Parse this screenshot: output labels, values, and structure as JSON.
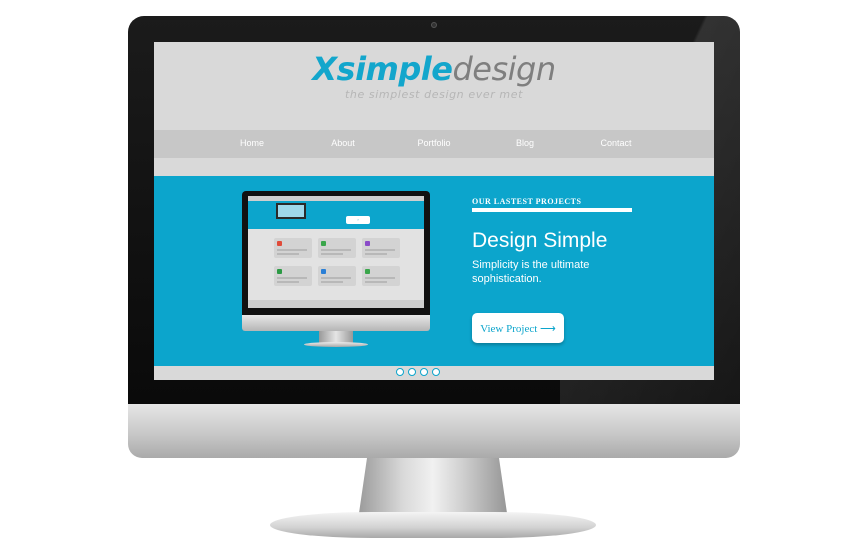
{
  "site": {
    "logo_strong": "Xsimple",
    "logo_light": "design",
    "tagline": "the simplest design ever met"
  },
  "nav": {
    "items": [
      {
        "label": "Home"
      },
      {
        "label": "About"
      },
      {
        "label": "Portfolio"
      },
      {
        "label": "Blog"
      },
      {
        "label": "Contact"
      }
    ]
  },
  "hero": {
    "section_label": "OUR LASTEST PROJECTS",
    "title": "Design Simple",
    "subtitle": "Simplicity is the ultimate sophistication.",
    "cta_label": "View Project ⟶"
  },
  "slider": {
    "dot_count": 4
  },
  "colors": {
    "accent": "#0ca5cc",
    "bezel": "#111111",
    "screen_bg": "#d9d9d9",
    "nav_bg": "#c7c7c7"
  }
}
